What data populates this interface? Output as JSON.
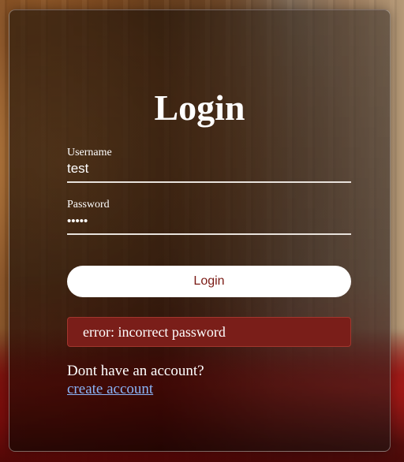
{
  "login": {
    "title": "Login",
    "username": {
      "label": "Username",
      "value": "test"
    },
    "password": {
      "label": "Password",
      "value": "•••••"
    },
    "submit_label": "Login",
    "error_message": "error: incorrect password",
    "signup_prompt": "Dont have an account?",
    "signup_link": "create account"
  },
  "colors": {
    "button_text": "#7a1a14",
    "error_background": "#7a1e19",
    "link": "#8ab4f8"
  }
}
